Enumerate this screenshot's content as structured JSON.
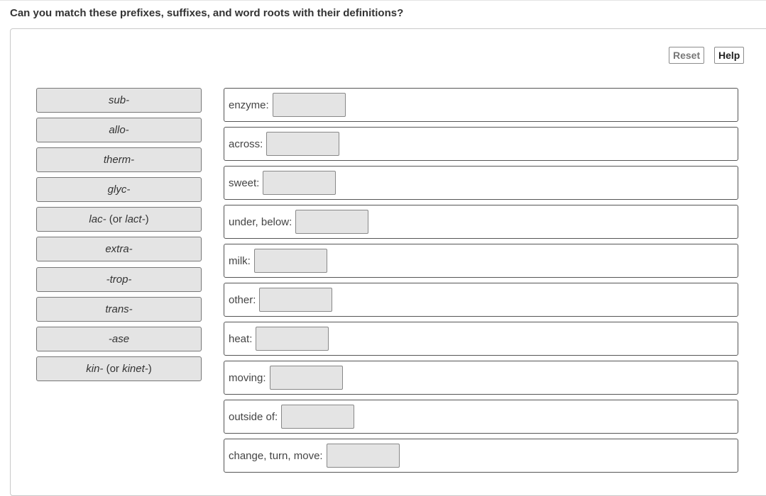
{
  "question": "Can you match these prefixes, suffixes, and word roots with their definitions?",
  "toolbar": {
    "reset_label": "Reset",
    "help_label": "Help"
  },
  "chips": [
    {
      "id": "sub",
      "term": "sub-",
      "alt": ""
    },
    {
      "id": "allo",
      "term": "allo-",
      "alt": ""
    },
    {
      "id": "therm",
      "term": "therm-",
      "alt": ""
    },
    {
      "id": "glyc",
      "term": "glyc-",
      "alt": ""
    },
    {
      "id": "lac",
      "term": "lac-",
      "alt": "lact-"
    },
    {
      "id": "extra",
      "term": "extra-",
      "alt": ""
    },
    {
      "id": "trop",
      "term": "-trop-",
      "alt": ""
    },
    {
      "id": "trans",
      "term": "trans-",
      "alt": ""
    },
    {
      "id": "ase",
      "term": "-ase",
      "alt": ""
    },
    {
      "id": "kin",
      "term": "kin-",
      "alt": "kinet-"
    }
  ],
  "alt_open": " (or ",
  "alt_close": ")",
  "definitions": [
    {
      "id": "enzyme",
      "label": "enzyme:"
    },
    {
      "id": "across",
      "label": "across:"
    },
    {
      "id": "sweet",
      "label": "sweet:"
    },
    {
      "id": "under-below",
      "label": "under, below:"
    },
    {
      "id": "milk",
      "label": "milk:"
    },
    {
      "id": "other",
      "label": "other:"
    },
    {
      "id": "heat",
      "label": "heat:"
    },
    {
      "id": "moving",
      "label": "moving:"
    },
    {
      "id": "outside-of",
      "label": "outside of:"
    },
    {
      "id": "change-turn-move",
      "label": "change, turn, move:"
    }
  ]
}
